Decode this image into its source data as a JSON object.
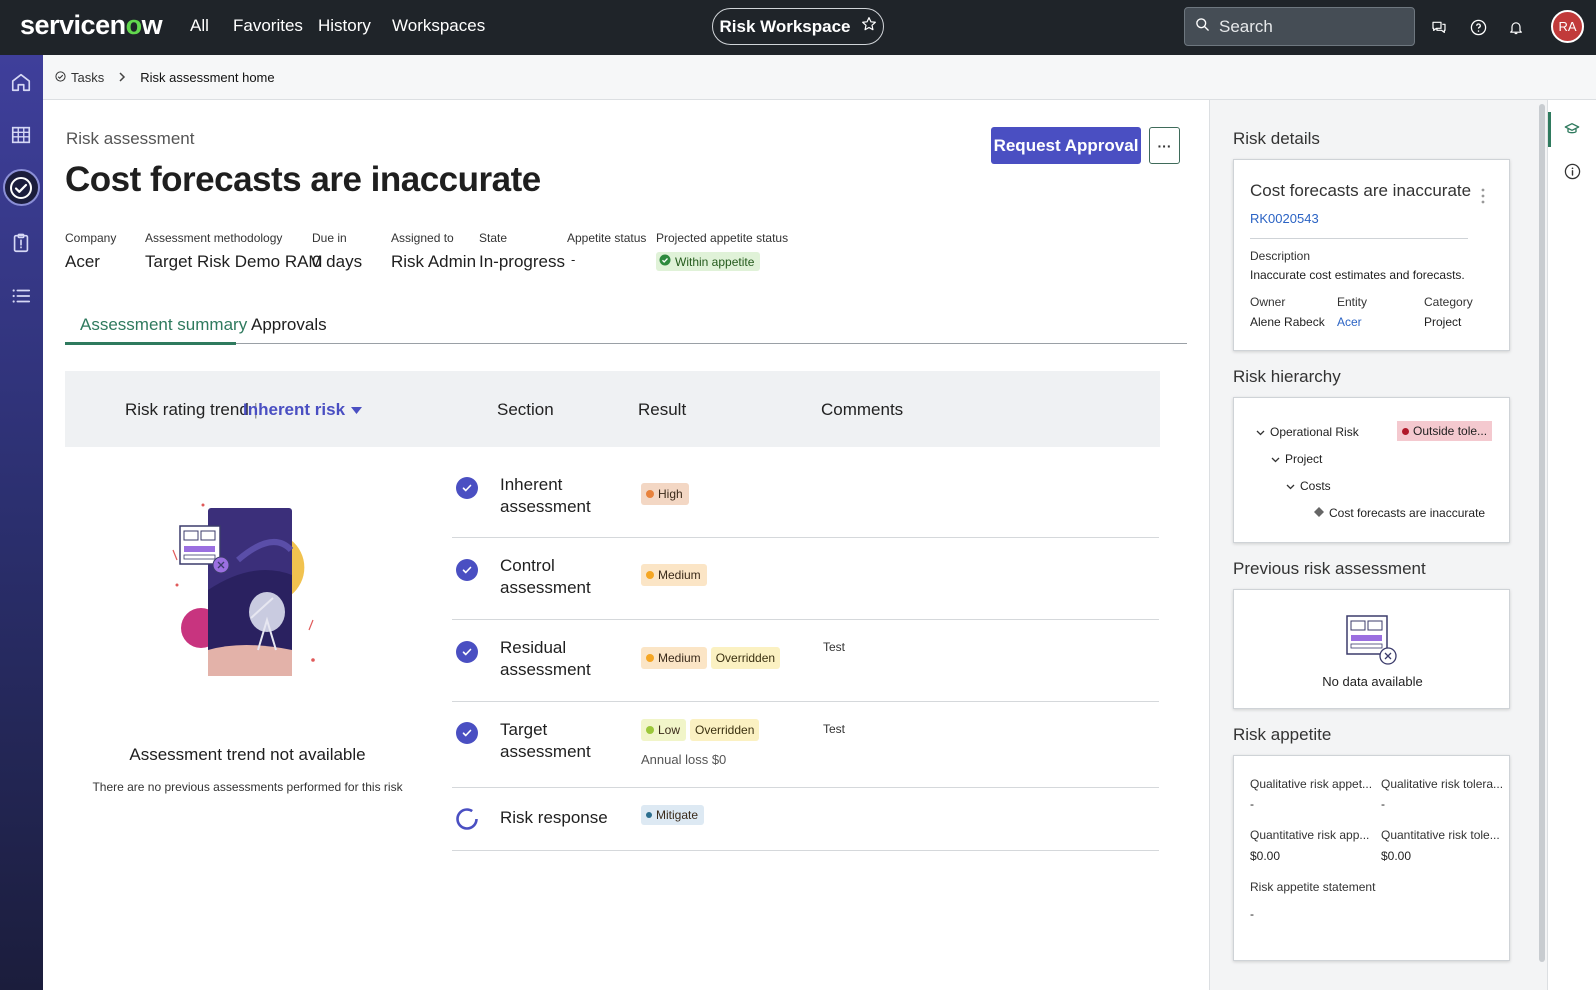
{
  "topbar": {
    "logo_text_a": "servicen",
    "logo_text_b": "w",
    "nav": [
      "All",
      "Favorites",
      "History",
      "Workspaces"
    ],
    "workspace_label": "Risk Workspace",
    "search_placeholder": "Search",
    "avatar_initials": "RA"
  },
  "breadcrumb": {
    "tasks": "Tasks",
    "current": "Risk assessment home"
  },
  "header": {
    "overline": "Risk assessment",
    "title": "Cost forecasts are inaccurate",
    "request_approval": "Request Approval",
    "more": "···"
  },
  "meta": [
    {
      "label": "Company",
      "value": "Acer"
    },
    {
      "label": "Assessment methodology",
      "value": "Target Risk Demo RAM"
    },
    {
      "label": "Due in",
      "value": "0 days"
    },
    {
      "label": "Assigned to",
      "value": "Risk Admin"
    },
    {
      "label": "State",
      "value": "In-progress"
    },
    {
      "label": "Appetite status",
      "value": "-"
    },
    {
      "label": "Projected appetite status",
      "value": "Within appetite"
    }
  ],
  "tabs": [
    "Assessment summary",
    "Approvals"
  ],
  "summary": {
    "trend_label": "Risk rating trend",
    "trend_divider": "|",
    "trend_select": "Inherent risk",
    "col_section": "Section",
    "col_result": "Result",
    "col_comments": "Comments",
    "empty_title": "Assessment trend not available",
    "empty_sub": "There are no previous assessments performed for this risk"
  },
  "rows": [
    {
      "section": "Inherent assessment",
      "result": "High",
      "color": "#f3d7c4",
      "dot": "#e8823c",
      "overridden": "",
      "comment": "",
      "sub": ""
    },
    {
      "section": "Control assessment",
      "result": "Medium",
      "color": "#fbe5c6",
      "dot": "#f5a623",
      "overridden": "",
      "comment": "",
      "sub": ""
    },
    {
      "section": "Residual assessment",
      "result": "Medium",
      "color": "#fbe5c6",
      "dot": "#f5a623",
      "overridden": "Overridden",
      "comment": "Test",
      "sub": ""
    },
    {
      "section": "Target assessment",
      "result": "Low",
      "color": "#f1f5c9",
      "dot": "#9bc73a",
      "overridden": "Overridden",
      "comment": "Test",
      "sub": "Annual loss $0"
    },
    {
      "section": "Risk response",
      "result": "Mitigate",
      "color": "#dde9f3",
      "dot": "#2c6e8e",
      "overridden": "",
      "comment": "",
      "sub": ""
    }
  ],
  "right": {
    "details_h": "Risk details",
    "details": {
      "title": "Cost forecasts are inaccurate",
      "number": "RK0020543",
      "desc_label": "Description",
      "desc": "Inaccurate cost estimates and forecasts.",
      "owner_label": "Owner",
      "owner": "Alene Rabeck",
      "entity_label": "Entity",
      "entity": "Acer",
      "category_label": "Category",
      "category": "Project"
    },
    "hierarchy_h": "Risk hierarchy",
    "hierarchy": {
      "l1": "Operational Risk",
      "l1_badge": "Outside tole...",
      "l2": "Project",
      "l3": "Costs",
      "l4": "Cost forecasts are inaccurate"
    },
    "prev_h": "Previous risk assessment",
    "prev_empty": "No data available",
    "appetite_h": "Risk appetite",
    "appetite": {
      "qual_app_label": "Qualitative risk appet...",
      "qual_app": "-",
      "qual_tol_label": "Qualitative risk tolera...",
      "qual_tol": "-",
      "quant_app_label": "Quantitative risk app...",
      "quant_app": "$0.00",
      "quant_tol_label": "Quantitative risk tole...",
      "quant_tol": "$0.00",
      "statement_label": "Risk appetite statement",
      "statement": "-"
    }
  },
  "colors": {
    "accent": "#4a4fc2",
    "tab_active": "#2f7a5e",
    "topbar": "#1f2429",
    "badge_outside": "#f4c9cf"
  }
}
